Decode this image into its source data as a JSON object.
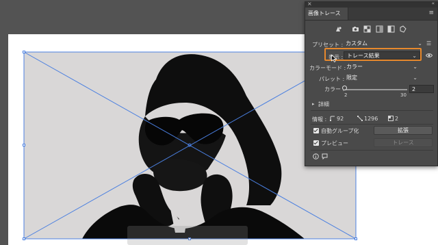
{
  "panel": {
    "title": "画像トレース",
    "close_symbol": "×",
    "collapse_symbol": "«",
    "menu_symbol": "≡",
    "preset_icons": [
      "auto-color-icon",
      "high-color-icon",
      "low-color-icon",
      "grayscale-icon",
      "black-and-white-icon",
      "outline-icon"
    ],
    "preset": {
      "label": "プリセット",
      "value": "カスタム"
    },
    "display": {
      "label": "表示",
      "value": "トレース結果"
    },
    "color_mode": {
      "label": "カラーモード",
      "value": "カラー"
    },
    "palette": {
      "label": "パレット",
      "value": "限定"
    },
    "colors": {
      "label": "カラー",
      "value": "2",
      "min": "2",
      "max": "30",
      "level": 0.0
    },
    "advanced": {
      "label": "詳細"
    },
    "info": {
      "label": "情報",
      "anchors": "92",
      "paths": "1296",
      "colors": "2"
    },
    "auto_group": {
      "label": "自動グループ化",
      "checked": true
    },
    "expand_button": "拡張",
    "preview": {
      "label": "プレビュー",
      "checked": true
    },
    "trace_button": "トレース"
  },
  "colors": {
    "accent": "#e8892c",
    "selection": "#4a7fe0",
    "panel_bg": "#4a4a4a",
    "canvas_bg": "#535353"
  }
}
